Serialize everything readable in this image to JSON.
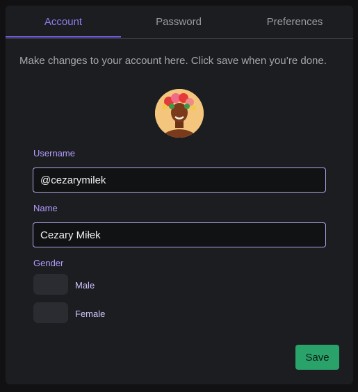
{
  "tabs": [
    {
      "label": "Account",
      "active": true
    },
    {
      "label": "Password",
      "active": false
    },
    {
      "label": "Preferences",
      "active": false
    }
  ],
  "account": {
    "description": "Make changes to your account here. Click save when you’re done.",
    "username": {
      "label": "Username",
      "value": "@cezarymilek"
    },
    "name": {
      "label": "Name",
      "value": "Cezary Miłek"
    },
    "gender": {
      "label": "Gender",
      "options": [
        {
          "label": "Male",
          "selected": false
        },
        {
          "label": "Female",
          "selected": false
        }
      ]
    },
    "save_label": "Save"
  },
  "colors": {
    "accent": "#8e7cf0",
    "field_label": "#b39cff",
    "save_button": "#2aa36a",
    "background": "#1c1d20"
  }
}
